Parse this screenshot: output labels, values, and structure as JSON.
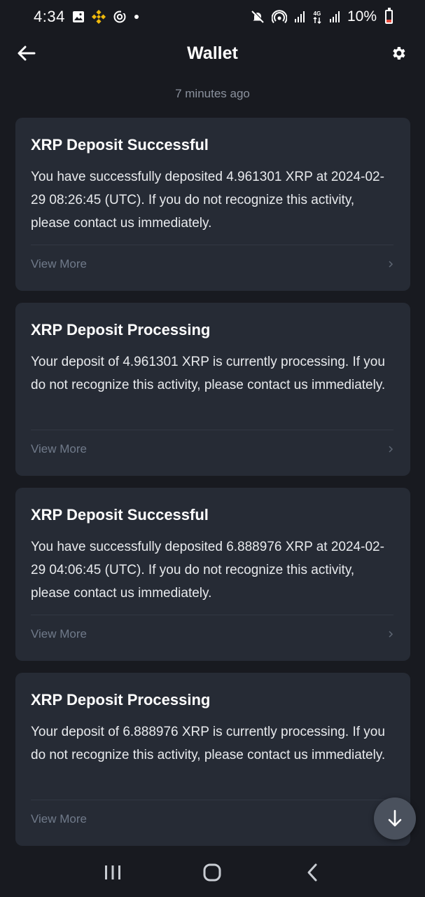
{
  "status_bar": {
    "time": "4:34",
    "battery": "10%",
    "icons_left": [
      "gallery-icon",
      "binance-icon",
      "sync-icon",
      "dot-icon"
    ],
    "icons_right": [
      "mute-icon",
      "hotspot-icon",
      "signal-icon",
      "4g-icon",
      "signal-icon",
      "battery-icon"
    ]
  },
  "header": {
    "title": "Wallet",
    "back_icon": "arrow-left-icon",
    "settings_icon": "gear-icon"
  },
  "timestamp": "7 minutes ago",
  "cards": [
    {
      "title": "XRP Deposit Successful",
      "body": "You have successfully deposited 4.961301 XRP at 2024-02-29 08:26:45 (UTC). If you do not recognize this activity, please contact us immediately.",
      "link": "View More"
    },
    {
      "title": "XRP Deposit Processing",
      "body": "Your deposit of 4.961301 XRP is currently processing. If you do not recognize this activity, please contact us immediately.",
      "link": "View More"
    },
    {
      "title": "XRP Deposit Successful",
      "body": "You have successfully deposited 6.888976 XRP at 2024-02-29 04:06:45 (UTC). If you do not recognize this activity, please contact us immediately.",
      "link": "View More"
    },
    {
      "title": "XRP Deposit Processing",
      "body": "Your deposit of 6.888976 XRP is currently processing. If you do not recognize this activity, please contact us immediately.",
      "link": "View More"
    }
  ],
  "colors": {
    "background": "#181a20",
    "card": "#262b35",
    "binance_yellow": "#f0b90b",
    "muted_text": "#707a8a"
  }
}
